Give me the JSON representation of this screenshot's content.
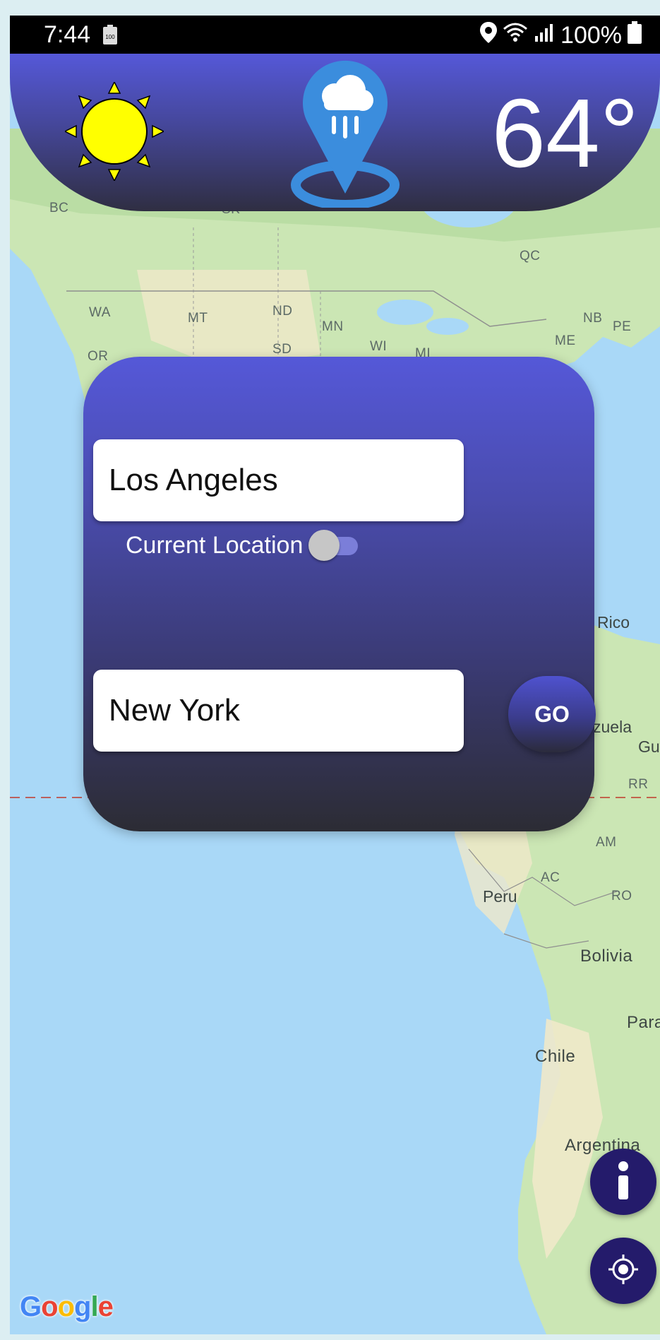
{
  "status_bar": {
    "time": "7:44",
    "battery_small_text": "100",
    "battery_percent": "100%",
    "icons": [
      "battery-saver-icon",
      "location-icon",
      "wifi-icon",
      "signal-icon",
      "battery-icon"
    ]
  },
  "header": {
    "weather_icon": "sun-icon",
    "app_icon": "rain-location-pin-icon",
    "temperature": "64°"
  },
  "route_form": {
    "origin_value": "Los Angeles",
    "current_location_label": "Current Location",
    "current_location_enabled": false,
    "destination_value": "New York",
    "go_label": "GO"
  },
  "map": {
    "attribution": "Google",
    "labels": [
      "BC",
      "SK",
      "QC",
      "WA",
      "MT",
      "ND",
      "MN",
      "NB",
      "PE",
      "OR",
      "SD",
      "WI",
      "MI",
      "ME",
      "Rico",
      "zuela",
      "Guy",
      "RR",
      "AM",
      "AC",
      "Peru",
      "RO",
      "Bolivia",
      "Para",
      "Chile",
      "Argentina"
    ]
  },
  "fabs": {
    "info_icon": "info-icon",
    "locate_icon": "my-location-icon"
  },
  "colors": {
    "header_gradient_top": "#5558d8",
    "header_gradient_bottom": "#2f2e42",
    "fab": "#241b6b",
    "pin_blue": "#3b8ddd",
    "sun_yellow": "#ffff00"
  }
}
